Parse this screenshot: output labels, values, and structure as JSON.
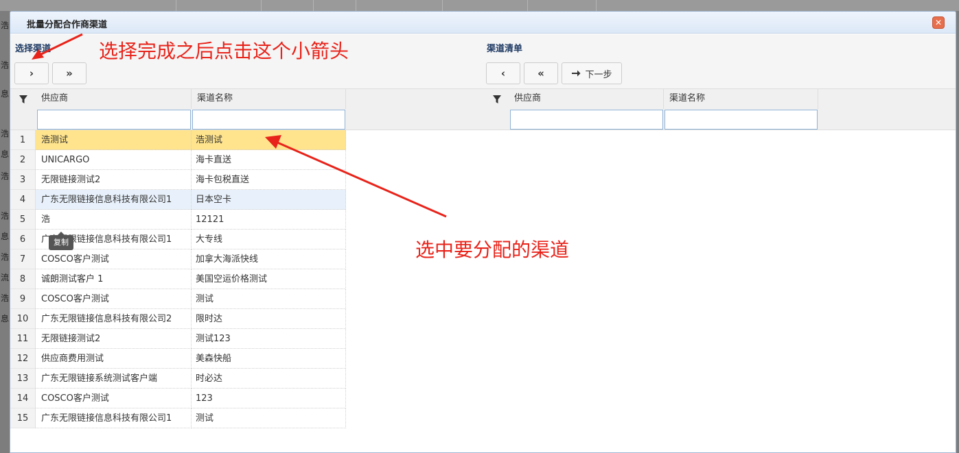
{
  "dialog": {
    "title": "批量分配合作商渠道",
    "close_glyph": "✕"
  },
  "left_panel": {
    "title": "选择渠道",
    "buttons": {
      "move_one": "›",
      "move_all": "»"
    },
    "columns": [
      "供应商",
      "渠道名称"
    ],
    "rows": [
      {
        "num": "1",
        "supplier": "浩测试",
        "channel": "浩测试"
      },
      {
        "num": "2",
        "supplier": "UNICARGO",
        "channel": "海卡直送"
      },
      {
        "num": "3",
        "supplier": "无限链接测试2",
        "channel": "海卡包税直送"
      },
      {
        "num": "4",
        "supplier": "广东无限链接信息科技有限公司1",
        "channel": "日本空卡"
      },
      {
        "num": "5",
        "supplier": "浩",
        "channel": "12121"
      },
      {
        "num": "6",
        "supplier": "广东无限链接信息科技有限公司1",
        "channel": "大专线"
      },
      {
        "num": "7",
        "supplier": "COSCO客户测试",
        "channel": "加拿大海派快线"
      },
      {
        "num": "8",
        "supplier": "诚朗测试客户 1",
        "channel": "美国空运价格测试"
      },
      {
        "num": "9",
        "supplier": "COSCO客户测试",
        "channel": "测试"
      },
      {
        "num": "10",
        "supplier": "广东无限链接信息科技有限公司2",
        "channel": "限时达"
      },
      {
        "num": "11",
        "supplier": "无限链接测试2",
        "channel": "测试123"
      },
      {
        "num": "12",
        "supplier": "供应商费用测试",
        "channel": "美森快船"
      },
      {
        "num": "13",
        "supplier": "广东无限链接系统测试客户端",
        "channel": "时必达"
      },
      {
        "num": "14",
        "supplier": "COSCO客户测试",
        "channel": "123"
      },
      {
        "num": "15",
        "supplier": "广东无限链接信息科技有限公司1",
        "channel": "测试"
      }
    ],
    "tooltip": "复制"
  },
  "right_panel": {
    "title": "渠道清单",
    "buttons": {
      "remove_one": "‹",
      "remove_all": "«",
      "next": "下一步"
    },
    "columns": [
      "供应商",
      "渠道名称"
    ]
  },
  "annotations": {
    "arrow_hint": "选择完成之后点击这个小箭头",
    "select_hint": "选中要分配的渠道",
    "color": "#e8231a"
  },
  "background": {
    "side_chars": [
      "浩",
      "浩",
      "息",
      "浩",
      "息",
      "浩",
      "浩",
      "息",
      "浩",
      "流",
      "浩",
      "息"
    ]
  }
}
